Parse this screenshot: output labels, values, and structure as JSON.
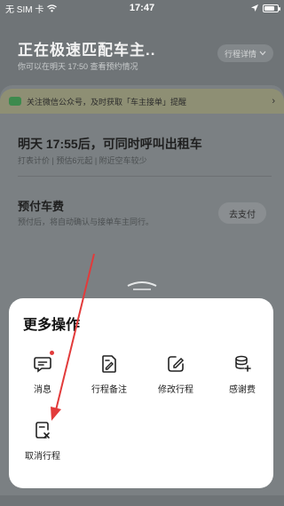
{
  "status_bar": {
    "carrier": "无 SIM 卡",
    "time": "17:47",
    "battery_level": 0.8
  },
  "header": {
    "title": "正在极速匹配车主..",
    "subtitle": "你可以在明天 17:50 查看预约情况",
    "trip_detail_label": "行程详情",
    "trip_detail_icon": "chevron-down-icon"
  },
  "wechat_banner": {
    "text": "关注微信公众号，及时获取「车主接单」提醒"
  },
  "taxi_option": {
    "title": "明天 17:55后，可同时呼叫出租车",
    "subtitle": "打表计价 | 预估6元起 | 附近空车较少"
  },
  "prepay": {
    "title": "预付车费",
    "subtitle": "预付后，将自动确认与接单车主同行。",
    "pay_button": "去支付"
  },
  "more_ops": {
    "title": "更多操作",
    "items": [
      {
        "label": "消息",
        "icon": "message-icon",
        "has_dot": true
      },
      {
        "label": "行程备注",
        "icon": "edit-note-icon",
        "has_dot": false
      },
      {
        "label": "修改行程",
        "icon": "edit-trip-icon",
        "has_dot": false
      },
      {
        "label": "感谢费",
        "icon": "tip-fee-icon",
        "has_dot": false
      },
      {
        "label": "取消行程",
        "icon": "cancel-trip-icon",
        "has_dot": false
      }
    ]
  },
  "colors": {
    "overlay": "#6f7477",
    "arrow": "#e23b3b",
    "badge": "#e23b3b",
    "wechat_green": "#3d8a4d"
  }
}
